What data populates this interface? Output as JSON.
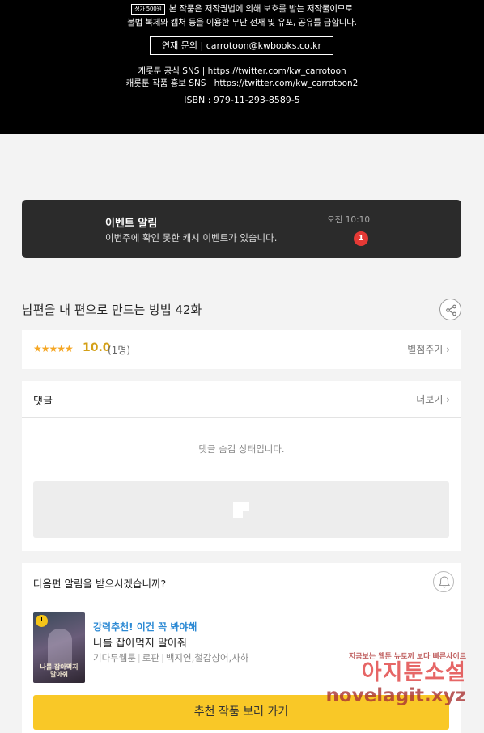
{
  "top_notice": {
    "price_tag": "정가 500원",
    "line1": "본 작품은 저작권법에 의해 보호를 받는 저작물이므로",
    "line2": "불법 복제와 캡처 등을 이용한 무단 전재 및 유포, 공유를 금합니다.",
    "contact": "연재 문의 | carrotoon@kwbooks.co.kr",
    "sns_official": "캐롯툰 공식 SNS | https://twitter.com/kw_carrotoon",
    "sns_promo": "캐롯툰 작품 홍보 SNS | https://twitter.com/kw_carrotoon2",
    "isbn": "ISBN : 979-11-293-8589-5"
  },
  "event": {
    "title": "이벤트 알림",
    "description": "이번주에 확인 못한 캐시 이벤트가 있습니다.",
    "time": "오전 10:10",
    "badge": "1"
  },
  "episode": {
    "title": "남편을 내 편으로 만드는 방법 42화"
  },
  "rating": {
    "stars": "★★★★★",
    "score": "10.0",
    "count": "(1명)",
    "rate_link": "별점주기"
  },
  "comments": {
    "title": "댓글",
    "more": "더보기",
    "hidden_message": "댓글 숨김 상태입니다."
  },
  "next_alert": {
    "question": "다음편 알림을 받으시겠습니까?"
  },
  "recommendation": {
    "tag": "강력추천! 이건 꼭 봐야해",
    "title": "나를 잡아먹지 말아줘",
    "meta": [
      "기다무웹툰",
      "로판",
      "백지연,철갑상어,사하"
    ],
    "cover_text": "나를 잡아먹지 말아줘",
    "button": "추천 작품 보러 가기"
  },
  "watermark": {
    "small": "지금보는 웹툰 뉴토끼 보다 빠른사이트",
    "big": "아지툰소설",
    "url": "novelagit.xyz"
  },
  "colors": {
    "accent_yellow": "#f9c827",
    "badge_red": "#e53935",
    "link_blue": "#2d8ad4",
    "rating_gold": "#d4a017"
  }
}
